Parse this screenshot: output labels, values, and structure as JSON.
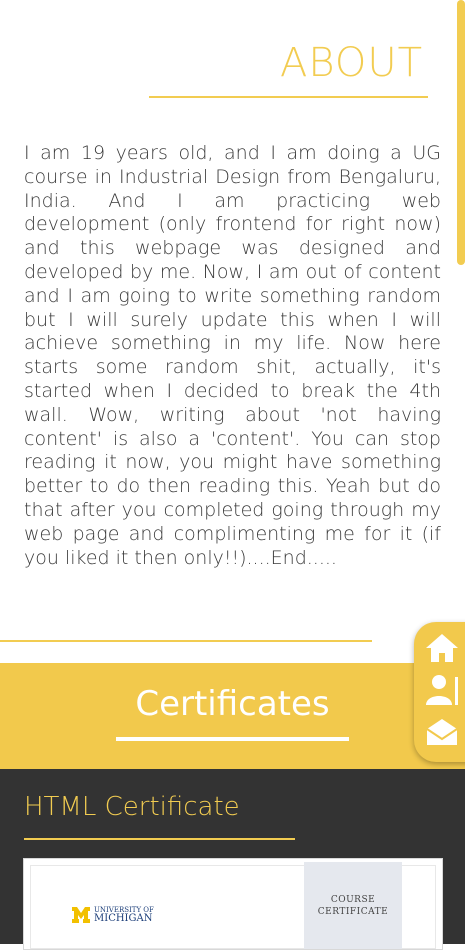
{
  "about": {
    "heading": "ABOUT",
    "text": "I am 19 years old, and I am doing a UG course in Industrial Design from Bengaluru, India. And I am practicing web development (only frontend for right now) and this webpage was designed and developed by me. Now, I am out of content and I am going to write something random but I will surely update this when I will achieve something in my life. Now here starts some random shit, actually, it's started when I decided to break the 4th wall. Wow, writing about 'not having content' is also a 'content'. You can stop reading it now, you might have something better to do then reading this. Yeah but do that after you completed going through my web page and complimenting me for it (if you liked it then only!!)....End....."
  },
  "certificates": {
    "heading": "Certificates",
    "items": [
      {
        "title": "HTML Certificate",
        "logo_line1": "UNIVERSITY OF",
        "logo_line2": "MICHIGAN",
        "side_label_line1": "COURSE",
        "side_label_line2": "CERTIFICATE"
      }
    ]
  },
  "side_nav": {
    "items": [
      {
        "icon": "home-icon"
      },
      {
        "icon": "user-icon"
      },
      {
        "icon": "mail-icon"
      }
    ]
  },
  "colors": {
    "accent": "#f2cc51",
    "dark": "#333333",
    "text": "#3a3a3a"
  }
}
